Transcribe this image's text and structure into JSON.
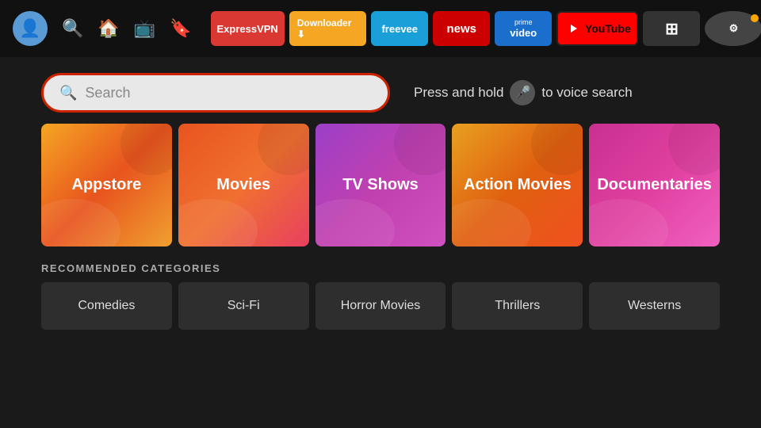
{
  "nav": {
    "avatar_icon": "👤",
    "icons": [
      "🔍",
      "🏠",
      "📺",
      "🔖"
    ],
    "apps": [
      {
        "label": "ExpressVPN",
        "class": "app-expressvpn",
        "name": "expressvpn-button"
      },
      {
        "label": "Downloader ⬇",
        "class": "app-downloader",
        "name": "downloader-button"
      },
      {
        "label": "freevee",
        "class": "app-freevee",
        "name": "freevee-button"
      },
      {
        "label": "news",
        "class": "app-news",
        "name": "news-button"
      },
      {
        "label": "prime video",
        "class": "app-prime",
        "name": "prime-video-button"
      },
      {
        "label": "YouTube",
        "class": "app-youtube",
        "name": "youtube-button"
      }
    ],
    "grid_icon": "⊞",
    "settings_icon": "⚙"
  },
  "search": {
    "placeholder": "Search",
    "voice_hint_prefix": "Press and hold",
    "voice_hint_suffix": "to voice search"
  },
  "categories": [
    {
      "label": "Appstore",
      "class": "card-appstore",
      "name": "appstore-card"
    },
    {
      "label": "Movies",
      "class": "card-movies",
      "name": "movies-card"
    },
    {
      "label": "TV Shows",
      "class": "card-tvshows",
      "name": "tvshows-card"
    },
    {
      "label": "Action Movies",
      "class": "card-action",
      "name": "action-movies-card"
    },
    {
      "label": "Documentaries",
      "class": "card-documentaries",
      "name": "documentaries-card"
    }
  ],
  "recommended": {
    "title": "RECOMMENDED CATEGORIES",
    "items": [
      {
        "label": "Comedies",
        "name": "comedies-rec"
      },
      {
        "label": "Sci-Fi",
        "name": "scifi-rec"
      },
      {
        "label": "Horror Movies",
        "name": "horror-movies-rec"
      },
      {
        "label": "Thrillers",
        "name": "thrillers-rec"
      },
      {
        "label": "Westerns",
        "name": "westerns-rec"
      }
    ]
  }
}
